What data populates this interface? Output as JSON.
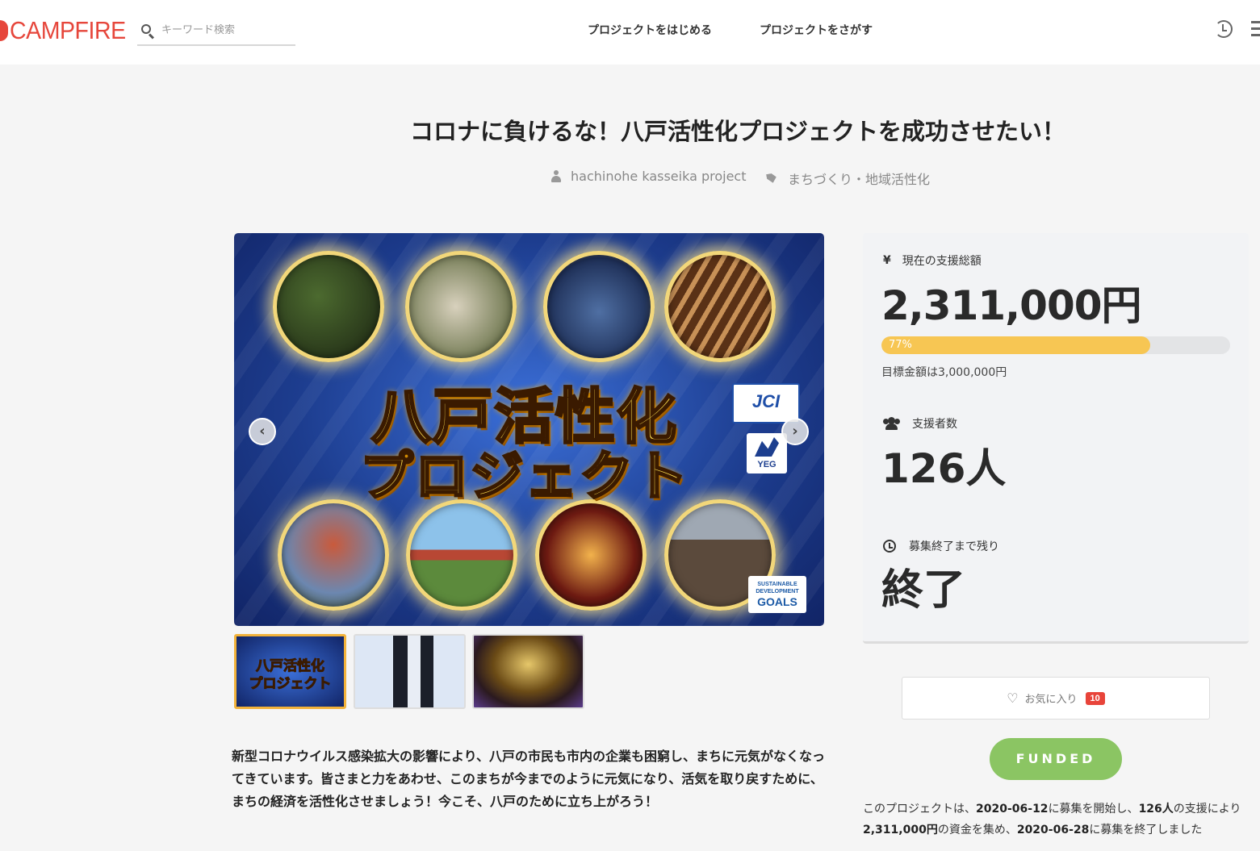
{
  "header": {
    "logo": "CAMPFIRE",
    "search_placeholder": "キーワード検索",
    "nav_start": "プロジェクトをはじめる",
    "nav_find": "プロジェクトをさがす"
  },
  "project": {
    "title": "コロナに負けるな！八戸活性化プロジェクトを成功させたい！",
    "owner": "hachinohe kasseika project",
    "category": "まちづくり・地域活性化",
    "hero_line1": "八戸活性化",
    "hero_line2": "プロジェクト",
    "badge_jci": "JCI",
    "badge_yeg": "YEG",
    "badge_sdg_top": "SUSTAINABLE DEVELOPMENT",
    "badge_sdg_bottom": "GOALS",
    "thumb1_line1": "八戸活性化",
    "thumb1_line2": "プロジェクト",
    "description": "新型コロナウイルス感染拡大の影響により、八戸の市民も市内の企業も困窮し、まちに元気がなくなってきています。皆さまと力をあわせ、このまちが今までのように元気になり、活気を取り戻すために、まちの経済を活性化させましょう！今こそ、八戸のために立ち上がろう！"
  },
  "stats": {
    "yen_symbol": "¥",
    "amount_label": "現在の支援総額",
    "amount": "2,311,000円",
    "progress_percent": 77,
    "progress_label": "77%",
    "goal": "目標金額は3,000,000円",
    "backers_label": "支援者数",
    "backers": "126人",
    "remaining_label": "募集終了まで残り",
    "remaining": "終了"
  },
  "actions": {
    "favorite_label": "お気に入り",
    "favorite_count": "10",
    "funded_label": "FUNDED"
  },
  "summary": {
    "prefix": "このプロジェクトは、",
    "start_date": "2020-06-12",
    "mid1": "に募集を開始し、",
    "backers": "126人",
    "mid2": "の支援により",
    "amount": "2,311,000円",
    "mid3": "の資金を集め、",
    "end_date": "2020-06-28",
    "suffix": "に募集を終了しました"
  },
  "colors": {
    "brand": "#e6463b",
    "progress": "#f7c653",
    "funded": "#8bc563",
    "badge": "#e8443a"
  },
  "icons": [
    "search-icon",
    "history-icon",
    "menu-icon",
    "user-icon",
    "tag-icon",
    "yen-icon",
    "users-icon",
    "clock-icon",
    "heart-icon",
    "arrow-left-icon",
    "arrow-right-icon"
  ]
}
